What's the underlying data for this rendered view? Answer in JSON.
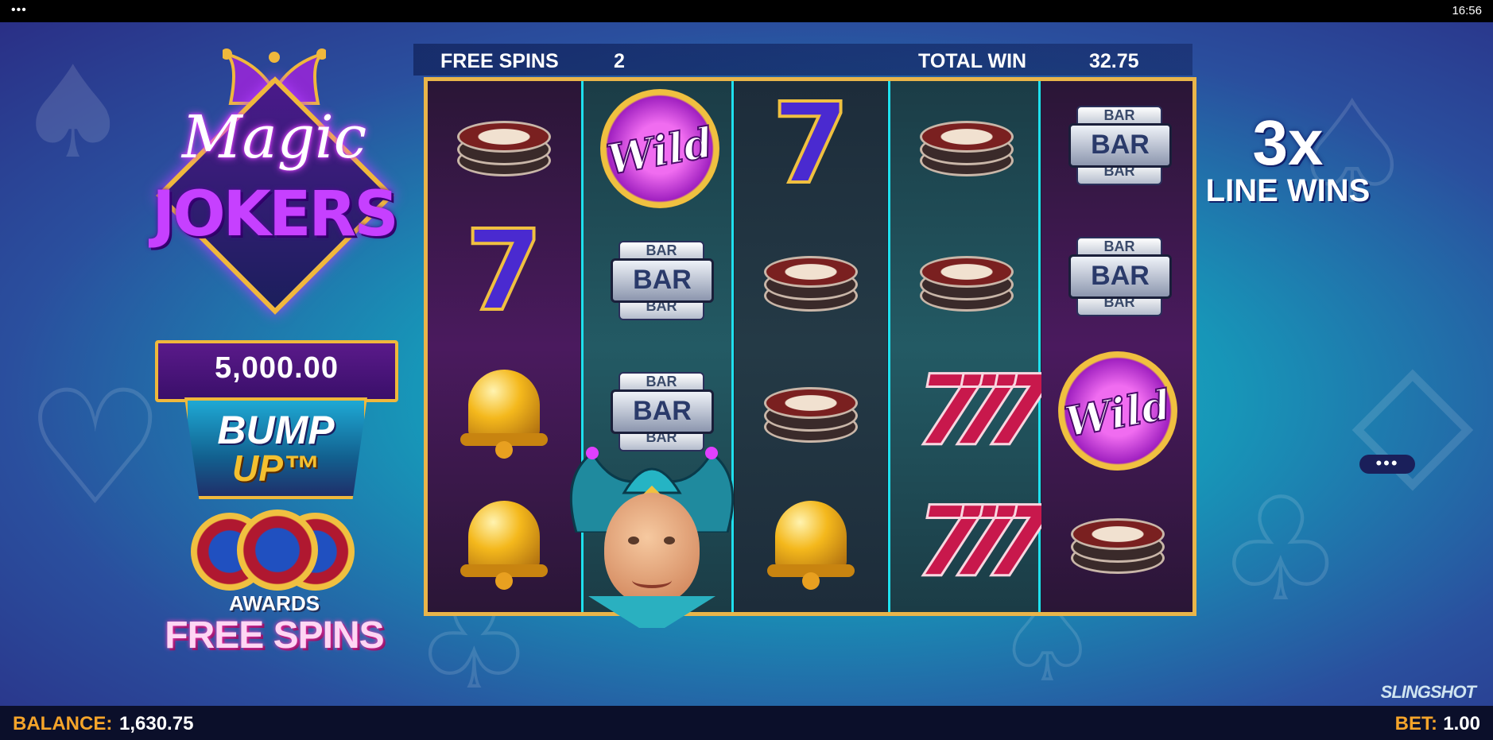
{
  "status": {
    "clock": "16:56",
    "menu_dots": "•••"
  },
  "logo": {
    "line1": "Magic",
    "line2": "JOKERS"
  },
  "jackpot": {
    "value": "5,000.00"
  },
  "bump_up": {
    "line1": "BUMP",
    "line2": "UP™"
  },
  "awards": {
    "line1": "AWARDS",
    "line2": "FREE SPINS"
  },
  "header": {
    "free_spins_label": "FREE SPINS",
    "free_spins_value": "2",
    "total_win_label": "TOTAL WIN",
    "total_win_value": "32.75"
  },
  "multiplier": {
    "value": "3x",
    "label": "LINE WINS"
  },
  "side_menu": "•••",
  "brand": "SLINGSHOT",
  "footer": {
    "balance_label": "BALANCE:",
    "balance_value": "1,630.75",
    "bet_label": "BET:",
    "bet_value": "1.00"
  },
  "reels": [
    [
      "chip",
      "seven-blue",
      "bell",
      "bell"
    ],
    [
      "wild",
      "bar",
      "bar",
      "joker"
    ],
    [
      "seven-blue",
      "chip",
      "chip",
      "bell"
    ],
    [
      "chip",
      "chip",
      "seven-red",
      "seven-red"
    ],
    [
      "bar",
      "bar",
      "wild",
      "chip"
    ]
  ],
  "symbol_text": {
    "wild": "Wild",
    "bar": "BAR",
    "seven": "7",
    "seven_triple": "777"
  },
  "colors": {
    "gold": "#e9b54a",
    "teal_highlight": "#1fe0ee",
    "balance_orange": "#f5a42a"
  }
}
